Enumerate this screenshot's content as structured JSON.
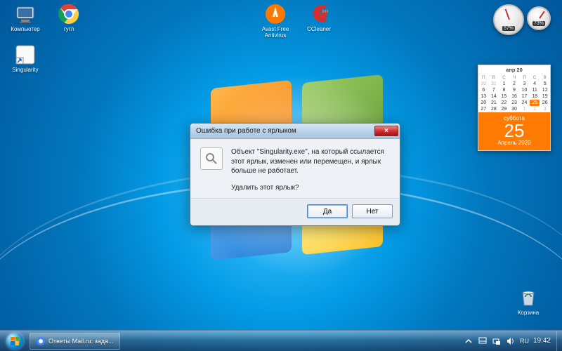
{
  "desktop_icons": {
    "computer": "Компьютер",
    "chrome": "гугл",
    "avast": "Avast Free Antivirus",
    "ccleaner": "CCleaner",
    "singularity": "Singularity",
    "recycle": "Корзина"
  },
  "dialog": {
    "title": "Ошибка при работе с ярлыком",
    "message": "Объект \"Singularity.exe\", на который ссылается этот ярлык, изменен или перемещен, и ярлык больше не работает.",
    "question": "Удалить этот ярлык?",
    "yes": "Да",
    "no": "Нет",
    "close": "×"
  },
  "taskbar": {
    "app1": "Ответы Mail.ru: зада...",
    "lang": "RU",
    "clock": "19:42"
  },
  "gadgets": {
    "cpu_pct": "57%",
    "ram_pct": "73%"
  },
  "calendar": {
    "header": "апр 20",
    "daynames": [
      "П",
      "В",
      "С",
      "Ч",
      "П",
      "С",
      "В"
    ],
    "leading_dim": [
      "30",
      "31"
    ],
    "days": [
      "1",
      "2",
      "3",
      "4",
      "5",
      "6",
      "7",
      "8",
      "9",
      "10",
      "11",
      "12",
      "13",
      "14",
      "15",
      "16",
      "17",
      "18",
      "19",
      "20",
      "21",
      "22",
      "23",
      "24",
      "25",
      "26",
      "27",
      "28",
      "29",
      "30"
    ],
    "trailing_dim": [
      "1",
      "2",
      "3"
    ],
    "today": "25",
    "dow": "суббота",
    "month_year": "Апрель 2020"
  }
}
